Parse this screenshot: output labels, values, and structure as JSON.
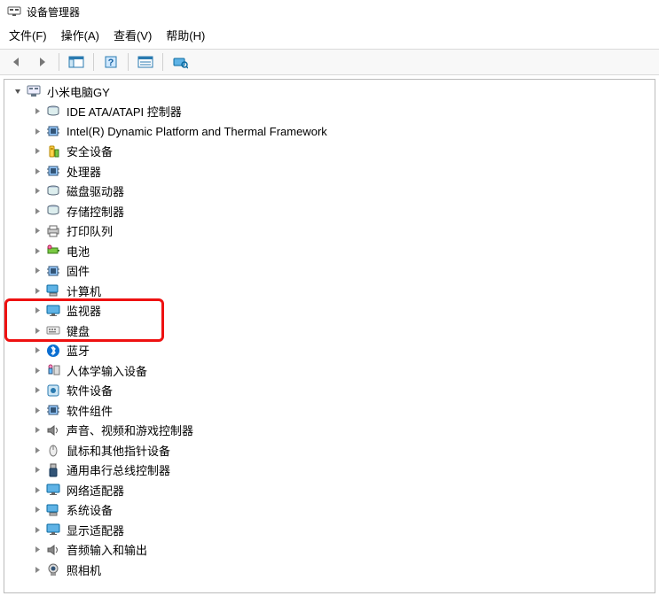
{
  "window": {
    "title": "设备管理器"
  },
  "menu": {
    "file": "文件(F)",
    "action": "操作(A)",
    "view": "查看(V)",
    "help": "帮助(H)"
  },
  "tree": {
    "root": {
      "label": "小米电脑GY"
    },
    "items": [
      {
        "label": "IDE ATA/ATAPI 控制器",
        "icon": "ide"
      },
      {
        "label": "Intel(R) Dynamic Platform and Thermal Framework",
        "icon": "chip"
      },
      {
        "label": "安全设备",
        "icon": "security"
      },
      {
        "label": "处理器",
        "icon": "cpu"
      },
      {
        "label": "磁盘驱动器",
        "icon": "disk"
      },
      {
        "label": "存储控制器",
        "icon": "storage"
      },
      {
        "label": "打印队列",
        "icon": "printer"
      },
      {
        "label": "电池",
        "icon": "battery"
      },
      {
        "label": "固件",
        "icon": "firmware"
      },
      {
        "label": "计算机",
        "icon": "computer"
      },
      {
        "label": "监视器",
        "icon": "monitor"
      },
      {
        "label": "键盘",
        "icon": "keyboard"
      },
      {
        "label": "蓝牙",
        "icon": "bluetooth"
      },
      {
        "label": "人体学输入设备",
        "icon": "hid"
      },
      {
        "label": "软件设备",
        "icon": "software"
      },
      {
        "label": "软件组件",
        "icon": "component"
      },
      {
        "label": "声音、视频和游戏控制器",
        "icon": "sound"
      },
      {
        "label": "鼠标和其他指针设备",
        "icon": "mouse"
      },
      {
        "label": "通用串行总线控制器",
        "icon": "usb"
      },
      {
        "label": "网络适配器",
        "icon": "network"
      },
      {
        "label": "系统设备",
        "icon": "system"
      },
      {
        "label": "显示适配器",
        "icon": "display"
      },
      {
        "label": "音频输入和输出",
        "icon": "audio"
      },
      {
        "label": "照相机",
        "icon": "camera"
      }
    ]
  },
  "highlight": {
    "start": 10,
    "end": 11
  }
}
